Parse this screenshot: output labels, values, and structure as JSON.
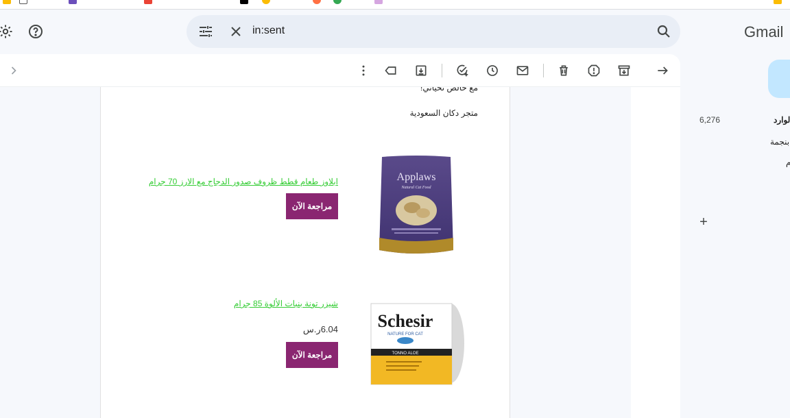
{
  "search": {
    "query": "in:sent"
  },
  "header": {
    "logo": "Gmail"
  },
  "sidebar": {
    "inbox_count": "6,276",
    "inbox_label": "الوارد",
    "starred_label": "بنجمة",
    "third_label": "م"
  },
  "email": {
    "line1": "مع خالص تحياتي!",
    "line2": "متجر دكان السعودية",
    "products": [
      {
        "link": "ابلاوز طعام قطط ظروف صدور الدجاج مع الارز 70 جرام",
        "button": "مراجعة الآن",
        "brand": "Applaws",
        "tagline": "Natural Cat Food"
      },
      {
        "link": "شيزر تونة بنبات الألوة 85 جرام",
        "price": "6.04ر.س",
        "button": "مراجعة الآن",
        "brand": "Schesir",
        "tagline": "NATURE FOR CAT",
        "flavor": "TONNO ALOE"
      }
    ]
  },
  "colors": {
    "accent_button": "#8a2671",
    "link": "#33cc33",
    "search_bg": "#e9eef6",
    "compose_bg": "#c2e7ff"
  }
}
